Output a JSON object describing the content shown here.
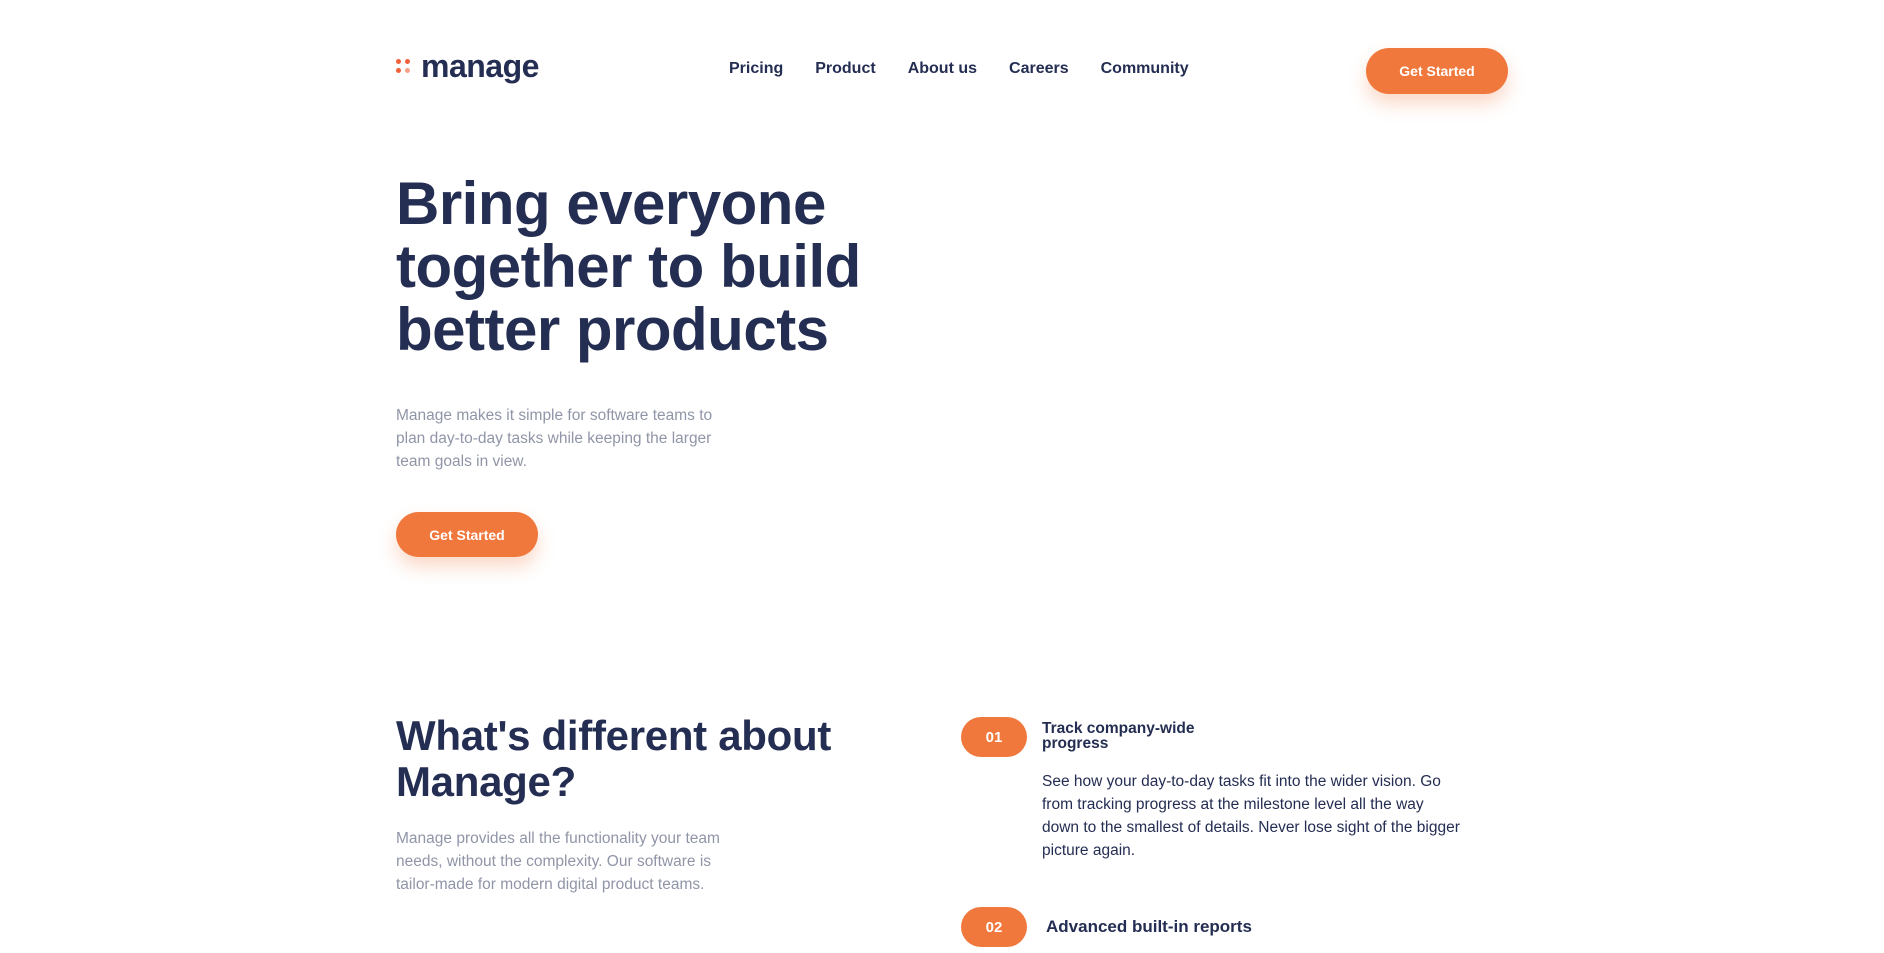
{
  "brand": {
    "name": "manage",
    "accent_color": "#f0783c",
    "text_color": "#242d52"
  },
  "nav": {
    "items": [
      "Pricing",
      "Product",
      "About us",
      "Careers",
      "Community"
    ],
    "cta": "Get Started"
  },
  "hero": {
    "title": "Bring everyone together to build better products",
    "description": "Manage makes it simple for software teams to plan day-to-day tasks while keeping the larger team goals in view.",
    "cta": "Get Started"
  },
  "different": {
    "title": "What's different about Manage?",
    "description": "Manage provides all the functionality your team needs, without the complexity. Our software is tailor-made for modern digital product teams.",
    "features": [
      {
        "number": "01",
        "title": "Track company-wide progress",
        "description": "See how your day-to-day tasks fit into the wider vision. Go from tracking progress at the milestone level all the way down to the smallest of details. Never lose sight of the bigger picture again."
      },
      {
        "number": "02",
        "title": "Advanced built-in reports"
      }
    ]
  }
}
